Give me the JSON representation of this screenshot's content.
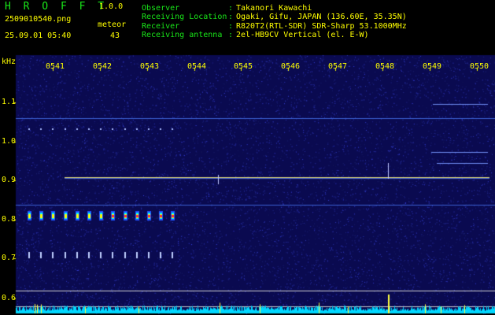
{
  "app": {
    "name": "H R O F F T",
    "version": "1.0.0"
  },
  "image": {
    "filename": "2509010540.png",
    "timestamp": "25.09.01 05:40"
  },
  "detection": {
    "label": "meteor",
    "count": "43"
  },
  "info": [
    {
      "label": "Observer",
      "value": "Takanori Kawachi"
    },
    {
      "label": "Receiving Location",
      "value": "Ogaki, Gifu, JAPAN (136.60E, 35.35N)"
    },
    {
      "label": "Receiver",
      "value": "R820T2(RTL-SDR) SDR-Sharp 53.1000MHz"
    },
    {
      "label": "Receiving antenna",
      "value": "2el-HB9CV Vertical (el. E-W)"
    }
  ],
  "separator": ":",
  "axis": {
    "unit": "kHz",
    "time_labels": [
      "0541",
      "0542",
      "0543",
      "0544",
      "0545",
      "0546",
      "0547",
      "0548",
      "0549",
      "0550"
    ],
    "freq_labels": [
      "1.1",
      "1.0",
      "0.9",
      "0.8",
      "0.7",
      "0.6"
    ]
  },
  "colors": {
    "label": "#19e619",
    "value": "#ffff00",
    "carrier": "#f0e068",
    "background": "#0a0a55",
    "trace": "#00e5ff"
  }
}
